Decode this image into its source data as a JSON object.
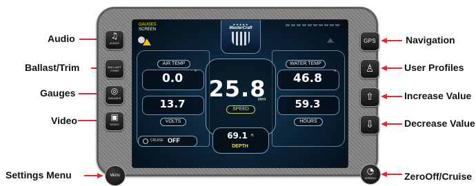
{
  "callouts": {
    "audio": "Audio",
    "ballast_trim": "Ballast/Trim",
    "gauges": "Gauges",
    "video": "Video",
    "settings_menu": "Settings Menu",
    "navigation": "Navigation",
    "user_profiles": "User Profiles",
    "increase_value": "Increase Value",
    "decrease_value": "Decrease Value",
    "zerooff_cruise": "ZeroOff/Cruise"
  },
  "buttons": {
    "audio": "AUDIO",
    "ballast": "BALLAST /TRIM",
    "gauges": "GAUGES",
    "video": "VIDEO",
    "menu": "MENU",
    "gps": "GPS",
    "speedo": "SPEEDO"
  },
  "screen": {
    "header_line1": "GAUGES",
    "header_line2": "SCREEN",
    "brand": "MasterCraft",
    "air_temp_label": "AIR TEMP",
    "air_temp_value": "0.0",
    "air_temp_unit": "°",
    "water_temp_label": "WATER TEMP",
    "water_temp_value": "46.8",
    "water_temp_unit": "°",
    "speed_value": "25.8",
    "speed_unit": "MPH",
    "speed_label": "SPEED",
    "volts_value": "13.7",
    "volts_label": "VOLTS",
    "hours_value": "59.3",
    "hours_label": "HOURS",
    "depth_value": "69.1",
    "depth_unit": "ft",
    "depth_label": "DEPTH",
    "cruise_label": "CRUISE",
    "cruise_state": "OFF"
  },
  "colors": {
    "arrow": "#e8262b",
    "accent_yellow": "#f2e600",
    "bezel": "#8a8a8a"
  }
}
